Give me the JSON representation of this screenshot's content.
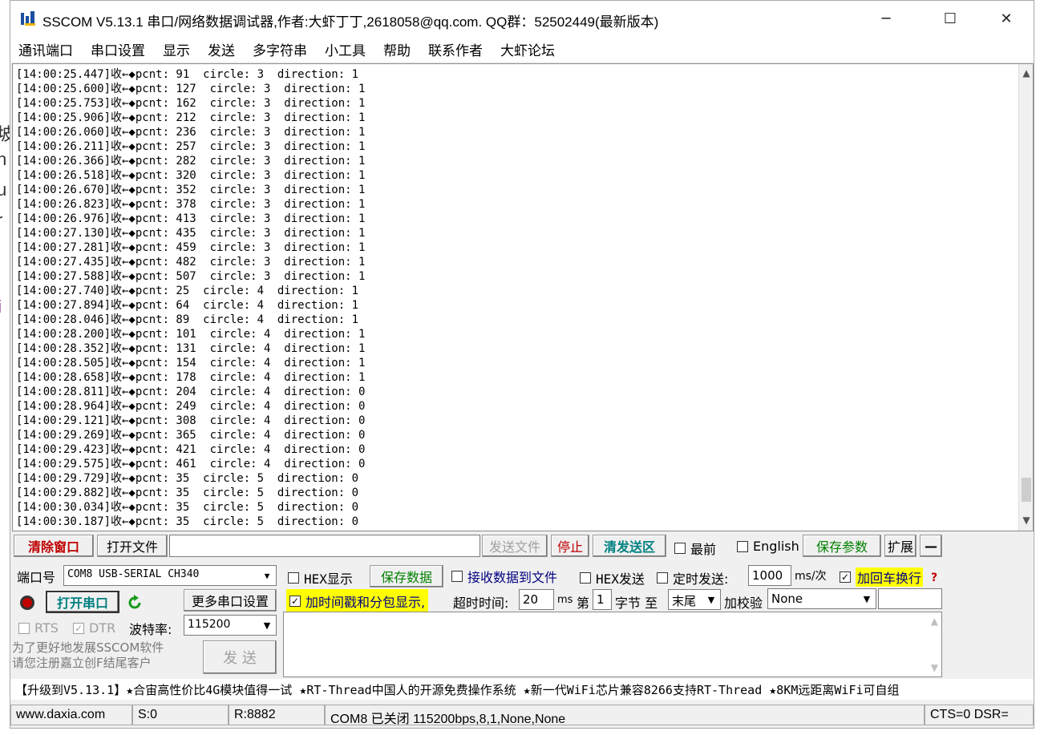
{
  "window": {
    "title": "SSCOM V5.13.1 串口/网络数据调试器,作者:大虾丁丁,2618058@qq.com. QQ群：52502449(最新版本)",
    "minimize_glyph": "─",
    "maximize_glyph": "☐",
    "close_glyph": "✕"
  },
  "background_letters": [
    "坡",
    "h",
    "u",
    "r",
    "i"
  ],
  "menu": [
    "通讯端口",
    "串口设置",
    "显示",
    "发送",
    "多字符串",
    "小工具",
    "帮助",
    "联系作者",
    "大虾论坛"
  ],
  "receive": {
    "lines": [
      "[14:00:25.447]收←◆pcnt: 91  circle: 3  direction: 1",
      "[14:00:25.600]收←◆pcnt: 127  circle: 3  direction: 1",
      "[14:00:25.753]收←◆pcnt: 162  circle: 3  direction: 1",
      "[14:00:25.906]收←◆pcnt: 212  circle: 3  direction: 1",
      "[14:00:26.060]收←◆pcnt: 236  circle: 3  direction: 1",
      "[14:00:26.211]收←◆pcnt: 257  circle: 3  direction: 1",
      "[14:00:26.366]收←◆pcnt: 282  circle: 3  direction: 1",
      "[14:00:26.518]收←◆pcnt: 320  circle: 3  direction: 1",
      "[14:00:26.670]收←◆pcnt: 352  circle: 3  direction: 1",
      "[14:00:26.823]收←◆pcnt: 378  circle: 3  direction: 1",
      "[14:00:26.976]收←◆pcnt: 413  circle: 3  direction: 1",
      "[14:00:27.130]收←◆pcnt: 435  circle: 3  direction: 1",
      "[14:00:27.281]收←◆pcnt: 459  circle: 3  direction: 1",
      "[14:00:27.435]收←◆pcnt: 482  circle: 3  direction: 1",
      "[14:00:27.588]收←◆pcnt: 507  circle: 3  direction: 1",
      "[14:00:27.740]收←◆pcnt: 25  circle: 4  direction: 1",
      "[14:00:27.894]收←◆pcnt: 64  circle: 4  direction: 1",
      "[14:00:28.046]收←◆pcnt: 89  circle: 4  direction: 1",
      "[14:00:28.200]收←◆pcnt: 101  circle: 4  direction: 1",
      "[14:00:28.352]收←◆pcnt: 131  circle: 4  direction: 1",
      "[14:00:28.505]收←◆pcnt: 154  circle: 4  direction: 1",
      "[14:00:28.658]收←◆pcnt: 178  circle: 4  direction: 1",
      "[14:00:28.811]收←◆pcnt: 204  circle: 4  direction: 0",
      "[14:00:28.964]收←◆pcnt: 249  circle: 4  direction: 0",
      "[14:00:29.121]收←◆pcnt: 308  circle: 4  direction: 0",
      "[14:00:29.269]收←◆pcnt: 365  circle: 4  direction: 0",
      "[14:00:29.423]收←◆pcnt: 421  circle: 4  direction: 0",
      "[14:00:29.575]收←◆pcnt: 461  circle: 4  direction: 0",
      "[14:00:29.729]收←◆pcnt: 35  circle: 5  direction: 0",
      "[14:00:29.882]收←◆pcnt: 35  circle: 5  direction: 0",
      "[14:00:30.034]收←◆pcnt: 35  circle: 5  direction: 0",
      "[14:00:30.187]收←◆pcnt: 35  circle: 5  direction: 0"
    ]
  },
  "toolbar": {
    "clear_window": "清除窗口",
    "open_file": "打开文件",
    "file_path": "",
    "send_file": "发送文件",
    "stop": "停止",
    "clear_send": "清发送区",
    "topmost": "最前",
    "english": "English",
    "save_params": "保存参数",
    "expand": "扩展",
    "collapse": "—"
  },
  "port": {
    "port_label": "端口号",
    "port_value": "COM8 USB-SERIAL CH340",
    "open_port": "打开串口",
    "more_settings": "更多串口设置",
    "rts": "RTS",
    "dtr": "DTR",
    "baud_label": "波特率:",
    "baud_value": "115200",
    "promo_line1": "为了更好地发展SSCOM软件",
    "promo_line2": "请您注册嘉立创F结尾客户",
    "send_button": "发  送"
  },
  "options": {
    "hex_display": "HEX显示",
    "save_data": "保存数据",
    "recv_to_file": "接收数据到文件",
    "hex_send": "HEX发送",
    "timed_send": "定时发送:",
    "interval": "1000",
    "interval_unit": "ms/次",
    "add_crlf": "加回车换行",
    "timestamp": "加时间戳和分包显示,",
    "timeout_label": "超时时间:",
    "timeout_value": "20",
    "timeout_unit": "ms",
    "byte_prefix": "第",
    "byte_value": "1",
    "byte_suffix": "字节 至",
    "end_value": "末尾",
    "checksum_label": "加校验",
    "checksum_value": "None",
    "help_mark": "?"
  },
  "ticker": "【升级到V5.13.1】★合宙高性价比4G模块值得一试 ★RT-Thread中国人的开源免费操作系统 ★新一代WiFi芯片兼容8266支持RT-Thread ★8KM远距离WiFi可自组",
  "status": {
    "website": "www.daxia.com",
    "sent": "S:0",
    "received": "R:8882",
    "port_state": "COM8 已关闭  115200bps,8,1,None,None",
    "signals": "CTS=0 DSR="
  }
}
